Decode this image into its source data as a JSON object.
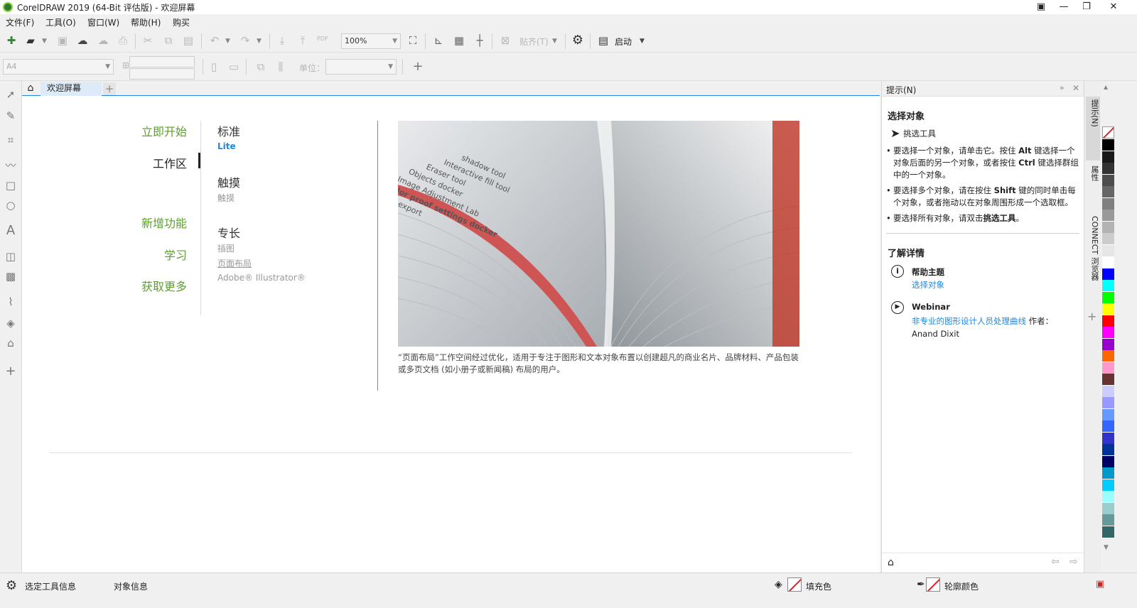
{
  "window": {
    "title": "CorelDRAW 2019 (64-Bit 评估版) - 欢迎屏幕",
    "minimize_icon": "minimize-icon",
    "maximize_icon": "restore-icon",
    "close_icon": "close-icon"
  },
  "menu": [
    "文件(F)",
    "工具(O)",
    "窗口(W)",
    "帮助(H)",
    "购买"
  ],
  "toolbar": {
    "zoom_value": "100%",
    "snap_label": "贴齐(T)",
    "launch_label": "启动",
    "pdf_label": "PDF"
  },
  "property_bar": {
    "page_size": "A4",
    "units_label": "单位：",
    "units_value": ""
  },
  "doc_tabs": {
    "tab_label": "欢迎屏幕",
    "add_label": "+"
  },
  "welcome": {
    "nav": [
      "立即开始",
      "工作区",
      "新增功能",
      "学习",
      "获取更多"
    ],
    "active_nav": "工作区",
    "groups": [
      {
        "heading": "标准",
        "items": [
          "Lite"
        ]
      },
      {
        "heading": "触摸",
        "items": [
          "触摸"
        ]
      },
      {
        "heading": "专长",
        "items": [
          "插图",
          "页面布局",
          "Adobe® Illustrator®"
        ]
      }
    ],
    "book_text": [
      "shadow tool",
      "Interactive fill tool",
      "Eraser tool",
      "Objects docker",
      "Image Adjustment Lab",
      "Color proof settings docker",
      "PDF export"
    ],
    "caption": "“页面布局”工作空间经过优化，适用于专注于图形和文本对象布置以创建超凡的商业名片、品牌材料、产品包装或多页文档 (如小册子或新闻稿) 布局的用户。"
  },
  "hints": {
    "header": "提示(N)",
    "section_title": "选择对象",
    "tool_name": "挑选工具",
    "bullets": [
      {
        "pre": "要选择一个对象，请单击它。按住 ",
        "b1": "Alt",
        "mid": " 键选择一个对象后面的另一个对象，或者按住 ",
        "b2": "Ctrl",
        "post": " 键选择群组中的一个对象。"
      },
      {
        "pre": "要选择多个对象，请在按住 ",
        "b1": "Shift",
        "mid": " 键的同时单击每个对象，或者拖动以在对象周围形成一个选取框。",
        "b2": "",
        "post": ""
      },
      {
        "pre": "要选择所有对象，请双击",
        "b1": "挑选工具",
        "mid": "。",
        "b2": "",
        "post": ""
      }
    ],
    "learn_title": "了解详情",
    "help_title": "帮助主题",
    "help_link": "选择对象",
    "webinar_title": "Webinar",
    "webinar_link": "非专业的图形设计人员处理曲线",
    "webinar_author": " 作者：Anand Dixit"
  },
  "dock_tabs": [
    "提示(N)",
    "属性",
    "CONNECT 浏览器"
  ],
  "palette": [
    "#000000",
    "#1a1a1a",
    "#333333",
    "#4d4d4d",
    "#666666",
    "#808080",
    "#999999",
    "#b3b3b3",
    "#cccccc",
    "#e6e6e6",
    "#ffffff",
    "#0000ff",
    "#00ffff",
    "#00ff00",
    "#ffff00",
    "#ff0000",
    "#ff00ff",
    "#9900cc",
    "#ff6600",
    "#ff99cc",
    "#663333",
    "#ccccff",
    "#9999ff",
    "#6699ff",
    "#3366ff",
    "#3333cc",
    "#003399",
    "#000066",
    "#0099cc",
    "#00ccff",
    "#99ffff",
    "#99cccc",
    "#669999",
    "#336666"
  ],
  "status": {
    "tool_info": "选定工具信息",
    "object_info": "对象信息",
    "fill_label": "填充色",
    "outline_label": "轮廓颜色"
  }
}
